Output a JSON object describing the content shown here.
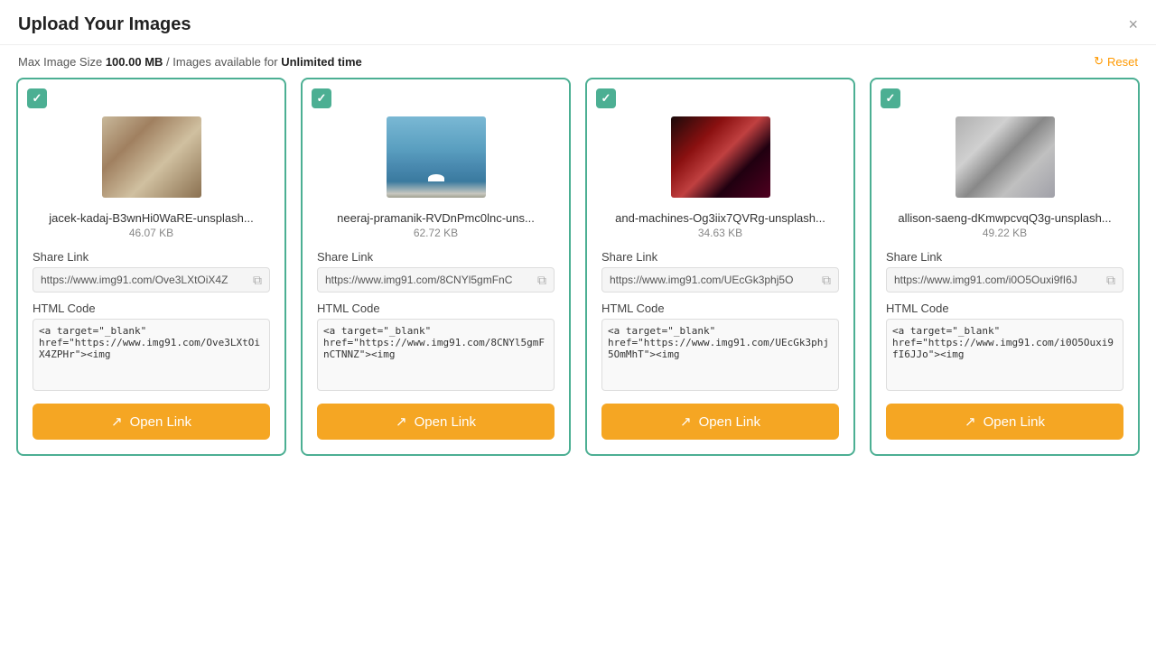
{
  "header": {
    "title": "Upload Your Images",
    "close_label": "×"
  },
  "subheader": {
    "text_prefix": "Max Image Size ",
    "max_size": "100.00 MB",
    "text_middle": " / Images available for ",
    "availability": "Unlimited time",
    "reset_label": "Reset"
  },
  "cards": [
    {
      "filename": "jacek-kadaj-B3wnHi0WaRE-unsplash...",
      "filesize": "46.07 KB",
      "share_link_label": "Share Link",
      "share_link": "https://www.img91.com/Ove3LXtOiX4Z",
      "html_code_label": "HTML Code",
      "html_code": "<a target=\"_blank\" href=\"https://www.img91.com/Ove3LXtOiX4ZPHr\"><img",
      "open_link_label": "Open Link",
      "img_class": "img-1"
    },
    {
      "filename": "neeraj-pramanik-RVDnPmc0lnc-uns...",
      "filesize": "62.72 KB",
      "share_link_label": "Share Link",
      "share_link": "https://www.img91.com/8CNYl5gmFnC",
      "html_code_label": "HTML Code",
      "html_code": "<a target=\"_blank\" href=\"https://www.img91.com/8CNYl5gmFnCTNNZ\"><img",
      "open_link_label": "Open Link",
      "img_class": "img-2"
    },
    {
      "filename": "and-machines-Og3iix7QVRg-unsplash...",
      "filesize": "34.63 KB",
      "share_link_label": "Share Link",
      "share_link": "https://www.img91.com/UEcGk3phj5O",
      "html_code_label": "HTML Code",
      "html_code": "<a target=\"_blank\" href=\"https://www.img91.com/UEcGk3phj5OmMhT\"><img",
      "open_link_label": "Open Link",
      "img_class": "img-3"
    },
    {
      "filename": "allison-saeng-dKmwpcvqQ3g-unsplash...",
      "filesize": "49.22 KB",
      "share_link_label": "Share Link",
      "share_link": "https://www.img91.com/i0O5Ouxi9fI6J",
      "html_code_label": "HTML Code",
      "html_code": "<a target=\"_blank\" href=\"https://www.img91.com/i0O5Ouxi9fI6JJo\"><img",
      "open_link_label": "Open Link",
      "img_class": "img-4"
    }
  ]
}
